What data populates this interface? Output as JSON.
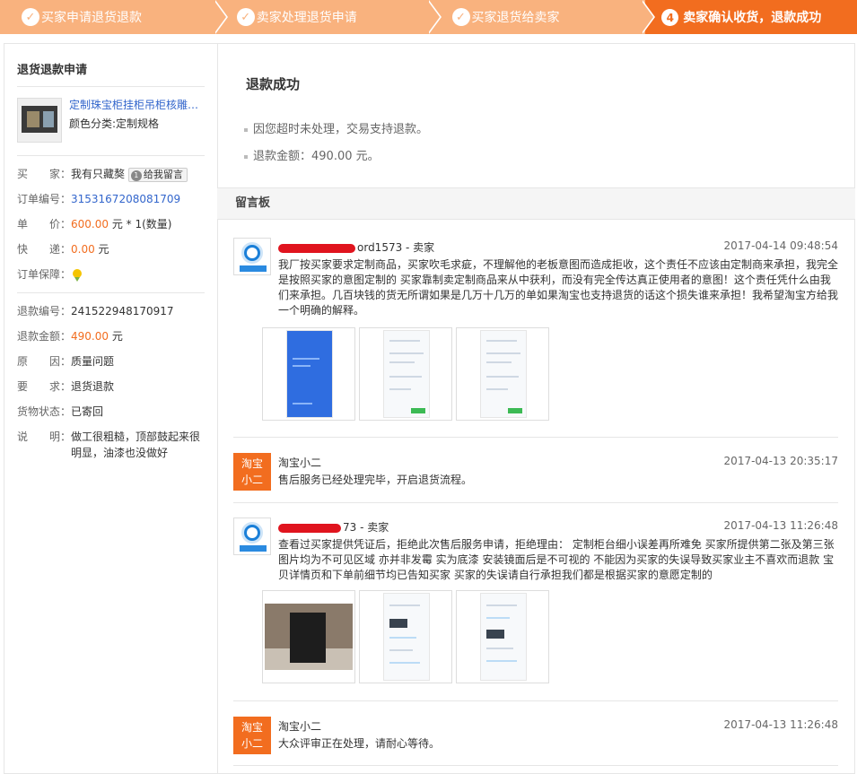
{
  "steps": [
    {
      "label": "买家申请退货退款",
      "icon": "check-icon"
    },
    {
      "label": "卖家处理退货申请",
      "icon": "check-icon"
    },
    {
      "label": "买家退货给卖家",
      "icon": "check-icon"
    },
    {
      "label": "卖家确认收货，退款成功",
      "number": "4"
    }
  ],
  "left": {
    "title": "退货退款申请",
    "product": {
      "name": "定制珠宝柜挂柜吊柜核雕展示柜",
      "spec": "颜色分类:定制规格"
    },
    "order": {
      "buyer_k": "买　　家：",
      "buyer_v": "我有只藏獒",
      "msg_btn": "给我留言",
      "msg_num": "1",
      "orderno_k": "订单编号：",
      "orderno_v": "3153167208081709",
      "price_k": "单　　价：",
      "price_v": "600.00",
      "price_suffix": " 元 * 1(数量)",
      "express_k": "快　　递：",
      "express_v": "0.00",
      "express_suffix": " 元",
      "guarantee_k": "订单保障："
    },
    "refund": {
      "no_k": "退款编号：",
      "no_v": "241522948170917",
      "amount_k": "退款金额：",
      "amount_v": "490.00",
      "amount_suffix": " 元",
      "reason_k": "原　　因：",
      "reason_v": "质量问题",
      "req_k": "要　　求：",
      "req_v": "退货退款",
      "goods_k": "货物状态：",
      "goods_v": "已寄回",
      "desc_k": "说　　明：",
      "desc_v": "做工很粗糙，顶部鼓起来很明显，油漆也没做好"
    }
  },
  "right": {
    "title": "退款成功",
    "line1": "因您超时未处理，交易支持退款。",
    "line2": "退款金额：490.00 元。",
    "board_title": "留言板",
    "messages": [
      {
        "who": "ord1573 - 卖家",
        "time": "2017-04-14 09:48:54",
        "content": "我厂按买家要求定制商品，买家吹毛求疵，不理解他的老板意图而造成拒收，这个责任不应该由定制商来承担，我完全是按照买家的意图定制的 买家靠制卖定制商品来从中获利，而没有完全传达真正使用者的意图！这个责任凭什么由我们来承担。几百块钱的货无所谓如果是几万十几万的单如果淘宝也支持退货的话这个损失谁来承担！我希望淘宝方给我一个明确的解释。"
      },
      {
        "who": "淘宝小二",
        "avatar": "淘宝小二",
        "time": "2017-04-13 20:35:17",
        "content": "售后服务已经处理完毕，开启退货流程。"
      },
      {
        "who": "73 - 卖家",
        "time": "2017-04-13 11:26:48",
        "content": "查看过买家提供凭证后，拒绝此次售后服务申请，拒绝理由： 定制柜台细小误差再所难免 买家所提供第二张及第三张图片均为不可见区域 亦并非发霉 实为底漆 安装镜面后是不可视的 不能因为买家的失误导致买家业主不喜欢而退款 宝贝详情页和下单前细节均已告知买家 买家的失误请自行承担我们都是根据买家的意愿定制的"
      },
      {
        "who": "淘宝小二",
        "avatar": "淘宝小二",
        "time": "2017-04-13 11:26:48",
        "content": "大众评审正在处理，请耐心等待。"
      }
    ]
  }
}
